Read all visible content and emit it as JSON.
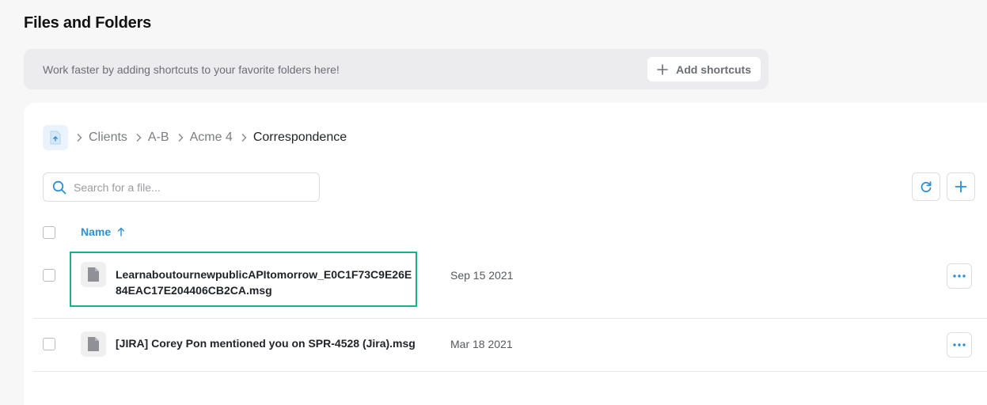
{
  "page": {
    "title": "Files and Folders"
  },
  "shortcuts": {
    "message": "Work faster by adding shortcuts to your favorite folders here!",
    "button_label": "Add shortcuts"
  },
  "breadcrumb": {
    "home_icon": "folder-home-icon",
    "items": [
      "Clients",
      "A-B",
      "Acme 4",
      "Correspondence"
    ]
  },
  "search": {
    "placeholder": "Search for a file...",
    "value": ""
  },
  "table": {
    "columns": {
      "name": "Name",
      "sort": "ascending"
    },
    "rows": [
      {
        "name": "LearnaboutournewpublicAPItomorrow_E0C1F73C9E26E84EAC17E204406CB2CA.msg",
        "date": "Sep 15 2021",
        "icon": "file-icon",
        "selected": false,
        "highlighted": true
      },
      {
        "name": "[JIRA] Corey Pon mentioned you on SPR-4528 (Jira).msg",
        "date": "Mar 18 2021",
        "icon": "file-icon",
        "selected": false,
        "highlighted": false
      }
    ]
  },
  "colors": {
    "accent": "#2d8fd9",
    "highlight": "#1cb08a"
  }
}
